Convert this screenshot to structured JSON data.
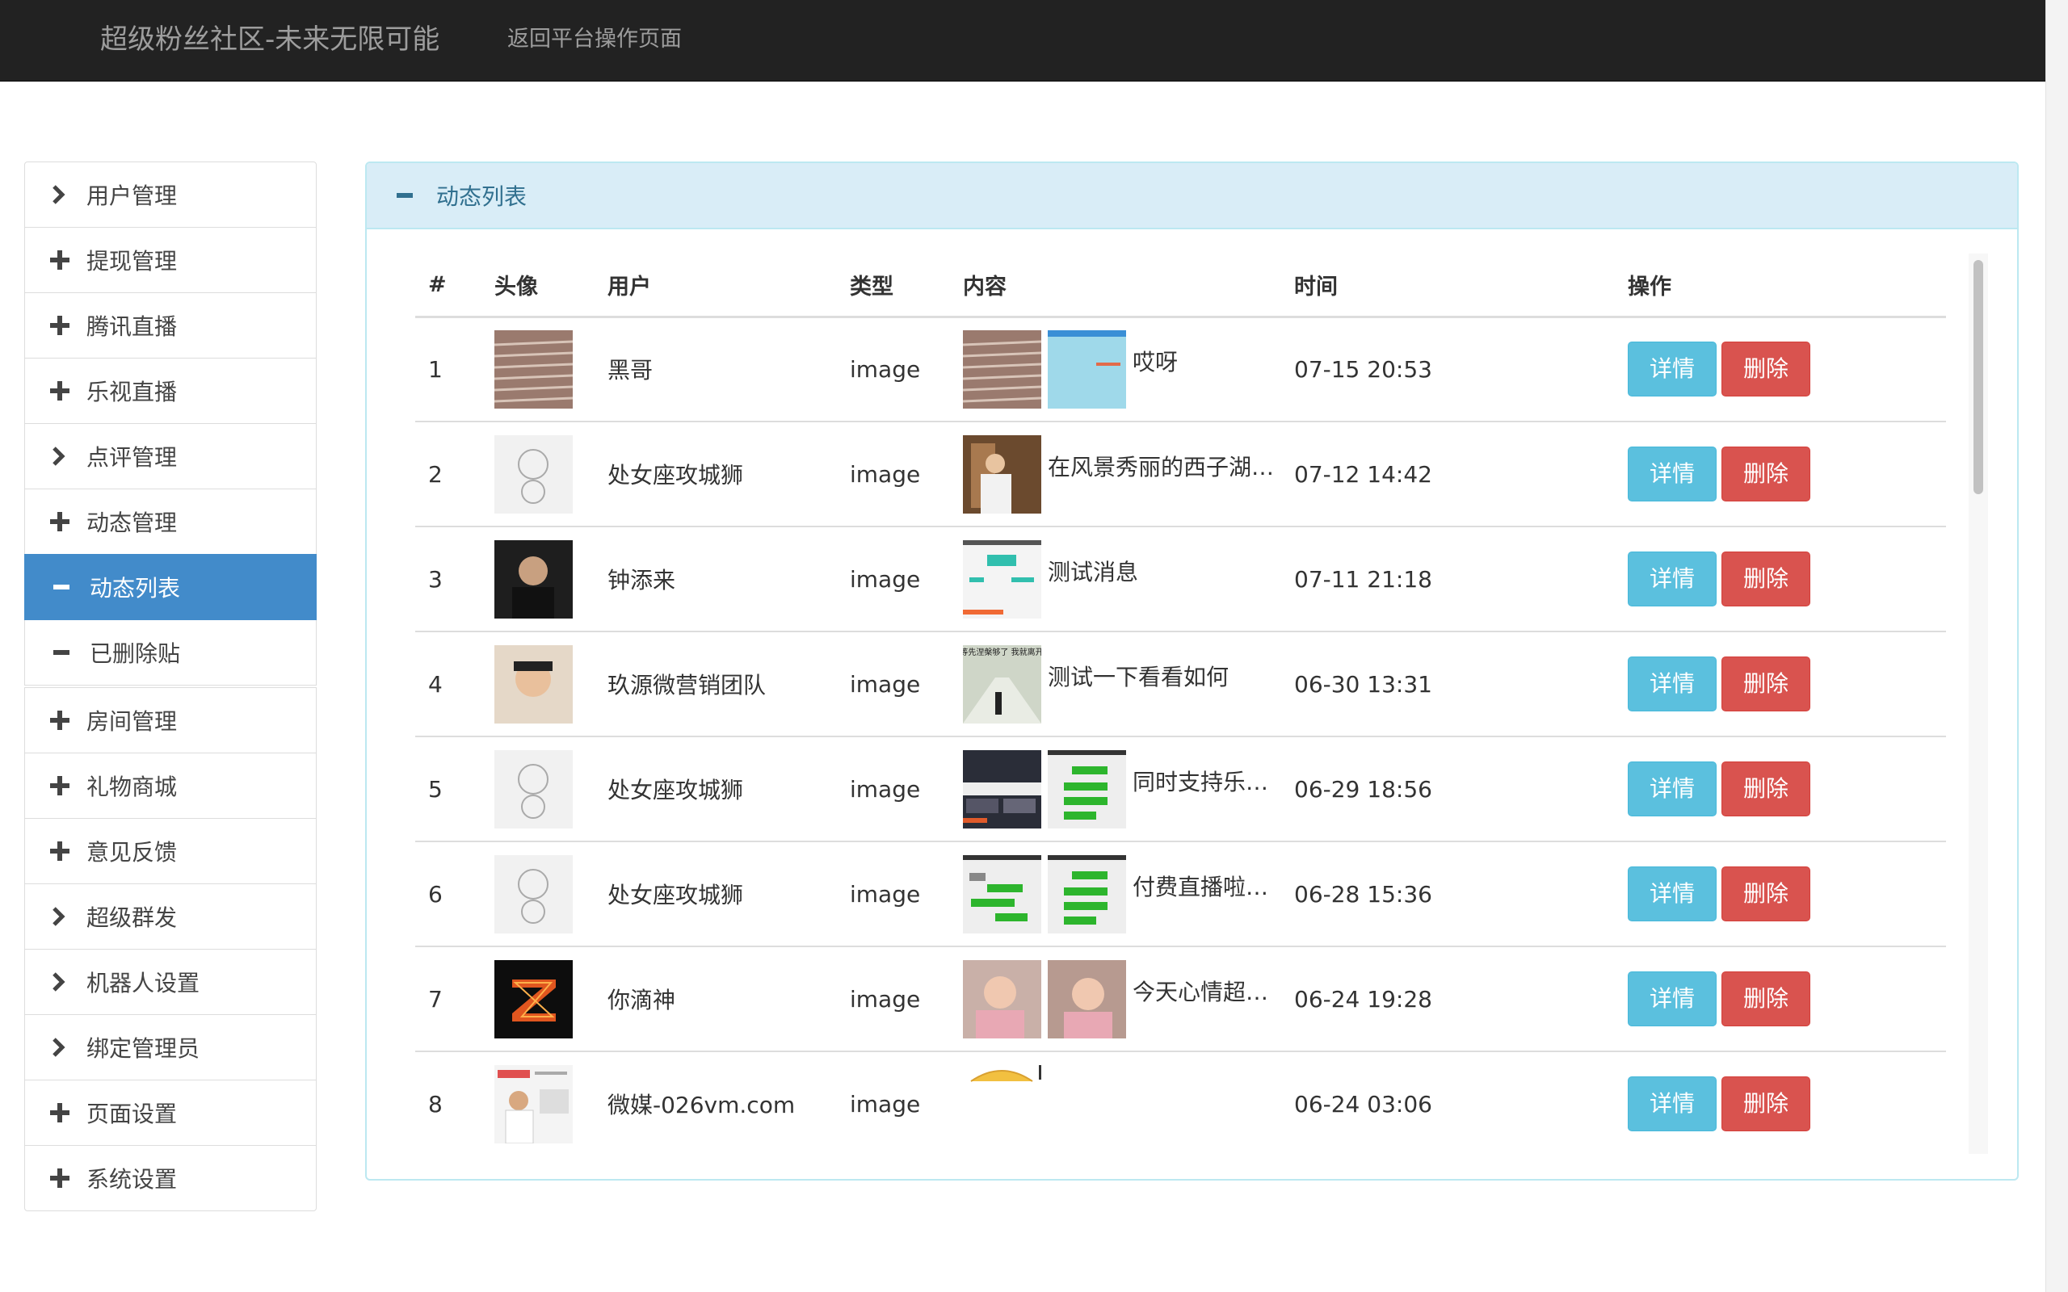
{
  "navbar": {
    "brand": "超级粉丝社区-未来无限可能",
    "back_link": "返回平台操作页面"
  },
  "sidebar": {
    "items": [
      {
        "label": "用户管理",
        "icon": "chevron-right-icon"
      },
      {
        "label": "提现管理",
        "icon": "plus-icon"
      },
      {
        "label": "腾讯直播",
        "icon": "plus-icon"
      },
      {
        "label": "乐视直播",
        "icon": "plus-icon"
      },
      {
        "label": "点评管理",
        "icon": "chevron-right-icon"
      },
      {
        "label": "动态管理",
        "icon": "plus-icon"
      },
      {
        "label": "动态列表",
        "icon": "minus-icon",
        "active": true
      },
      {
        "label": "已删除贴",
        "icon": "minus-icon"
      },
      {
        "label": "房间管理",
        "icon": "plus-icon"
      },
      {
        "label": "礼物商城",
        "icon": "plus-icon"
      },
      {
        "label": "意见反馈",
        "icon": "plus-icon"
      },
      {
        "label": "超级群发",
        "icon": "chevron-right-icon"
      },
      {
        "label": "机器人设置",
        "icon": "chevron-right-icon"
      },
      {
        "label": "绑定管理员",
        "icon": "chevron-right-icon"
      },
      {
        "label": "页面设置",
        "icon": "plus-icon"
      },
      {
        "label": "系统设置",
        "icon": "plus-icon"
      }
    ]
  },
  "panel": {
    "title": "动态列表",
    "icon": "minus-icon"
  },
  "table": {
    "headers": [
      "#",
      "头像",
      "用户",
      "类型",
      "内容",
      "时间",
      "操作"
    ],
    "rows": [
      {
        "num": "1",
        "user": "黑哥",
        "type": "image",
        "content": "哎呀",
        "time": "07-15 20:53"
      },
      {
        "num": "2",
        "user": "处女座攻城狮",
        "type": "image",
        "content": "在风景秀丽的西子湖…",
        "time": "07-12 14:42"
      },
      {
        "num": "3",
        "user": "钟添来",
        "type": "image",
        "content": "测试消息",
        "time": "07-11 21:18"
      },
      {
        "num": "4",
        "user": "玖源微营销团队",
        "type": "image",
        "content": "测试一下看看如何",
        "time": "06-30 13:31"
      },
      {
        "num": "5",
        "user": "处女座攻城狮",
        "type": "image",
        "content": "同时支持乐…",
        "time": "06-29 18:56"
      },
      {
        "num": "6",
        "user": "处女座攻城狮",
        "type": "image",
        "content": "付费直播啦…",
        "time": "06-28 15:36"
      },
      {
        "num": "7",
        "user": "你滴神",
        "type": "image",
        "content": "今天心情超…",
        "time": "06-24 19:28"
      },
      {
        "num": "8",
        "user": "微媒-026vm.com",
        "type": "image",
        "content": "",
        "time": "06-24 03:06"
      }
    ],
    "detail_label": "详情",
    "delete_label": "删除",
    "thumb_overlay_text": "等先涅槃够了 我就离开"
  },
  "colors": {
    "navbar_bg": "#222222",
    "active_blue": "#428bca",
    "panel_header_bg": "#d9edf7",
    "info_button": "#5bc0de",
    "danger_button": "#d9534f"
  }
}
